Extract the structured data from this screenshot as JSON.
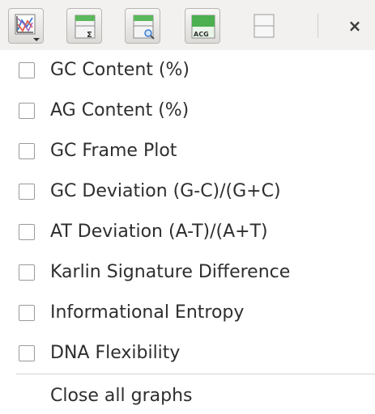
{
  "toolbar": {
    "buttons": [
      {
        "icon": "graph-chart-icon",
        "label": ""
      },
      {
        "icon": "sum-panel-icon",
        "label": "Σ"
      },
      {
        "icon": "zoom-panel-icon",
        "label": ""
      },
      {
        "icon": "acg-panel-icon",
        "label": "ACG"
      },
      {
        "icon": "split-panel-icon",
        "label": ""
      }
    ],
    "close_label": "×"
  },
  "menu": {
    "items": [
      {
        "label": "GC Content (%)",
        "checked": false
      },
      {
        "label": "AG Content (%)",
        "checked": false
      },
      {
        "label": "GC Frame Plot",
        "checked": false
      },
      {
        "label": "GC Deviation (G-C)/(G+C)",
        "checked": false
      },
      {
        "label": "AT Deviation (A-T)/(A+T)",
        "checked": false
      },
      {
        "label": "Karlin Signature Difference",
        "checked": false
      },
      {
        "label": "Informational Entropy",
        "checked": false
      },
      {
        "label": "DNA Flexibility",
        "checked": false
      }
    ],
    "close_all_label": "Close all graphs"
  },
  "colors": {
    "accent_blue": "#3a7bd5",
    "accent_green": "#4caf50",
    "accent_red": "#e05a47"
  }
}
